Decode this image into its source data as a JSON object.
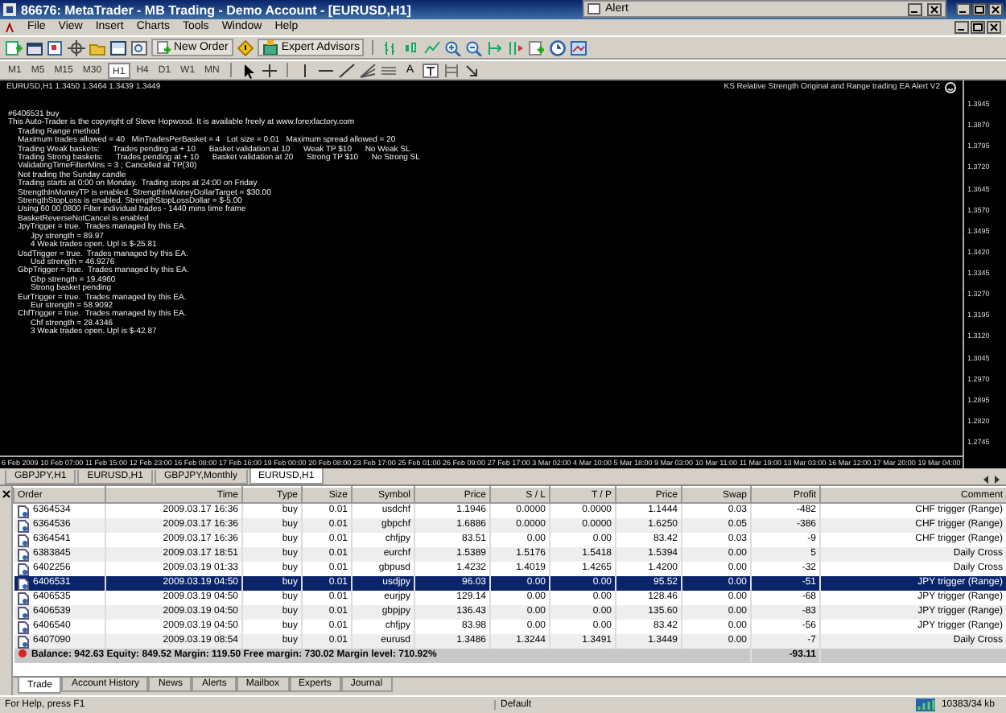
{
  "window": {
    "title": "86676: MetaTrader - MB Trading - Demo Account - [EURUSD,H1]"
  },
  "alert_window": {
    "title": "Alert"
  },
  "menu": [
    "File",
    "View",
    "Insert",
    "Charts",
    "Tools",
    "Window",
    "Help"
  ],
  "toolbar": {
    "buttons": [
      {
        "label": "New Order"
      },
      {
        "label": "Expert Advisors"
      }
    ]
  },
  "timeframes": [
    {
      "label": "M1",
      "selected": false
    },
    {
      "label": "M5",
      "selected": false
    },
    {
      "label": "M15",
      "selected": false
    },
    {
      "label": "M30",
      "selected": false
    },
    {
      "label": "H1",
      "selected": true
    },
    {
      "label": "H4",
      "selected": false
    },
    {
      "label": "D1",
      "selected": false
    },
    {
      "label": "W1",
      "selected": false
    },
    {
      "label": "MN",
      "selected": false
    }
  ],
  "drawing_tools": {
    "text_tool": "A"
  },
  "chart": {
    "header": "EURUSD,H1  1.3450 1.3464 1.3439 1.3449",
    "ea_name": "KS Relative Strength Original and Range trading EA Alert V2",
    "log": [
      {
        "kind": "title",
        "text": "#6406531 buy"
      },
      {
        "kind": "title",
        "text": "This Auto-Trader is the copyright of Steve Hopwood. It is available freely at www.forexfactory.com"
      },
      {
        "kind": "setting",
        "text": "Trading Range method"
      },
      {
        "kind": "setting",
        "text": "Maximum trades allowed = 40   MinTradesPerBasket = 4   Lot size = 0.01   Maximum spread allowed = 20"
      },
      {
        "kind": "setting",
        "text": "Trading Weak baskets:      Trades pending at + 10      Basket validation at 10      Weak TP $10      No Weak SL"
      },
      {
        "kind": "setting",
        "text": "Trading Strong baskets:      Trades pending at + 10      Basket validation at 20      Strong TP $10      No Strong SL"
      },
      {
        "kind": "setting",
        "text": "ValidatingTimeFilterMins = 3 ; Cancelled at TP(30)"
      },
      {
        "kind": "setting",
        "text": "Not trading the Sunday candle"
      },
      {
        "kind": "setting",
        "text": "Trading starts at 0:00 on Monday.  Trading stops at 24:00 on Friday"
      },
      {
        "kind": "setting",
        "text": "StrengthInMoneyTP is enabled. StrengthInMoneyDollarTarget = $30.00"
      },
      {
        "kind": "setting",
        "text": "StrengthStopLoss is enabled. StrengthStopLossDollar = $-5.00"
      },
      {
        "kind": "setting",
        "text": "Using 60 00 0800 Filter individual trades - 1440 mins time frame"
      },
      {
        "kind": "setting",
        "text": "BasketReverseNotCancel is enabled"
      },
      {
        "kind": "setting",
        "text": "JpyTrigger = true.  Trades managed by this EA."
      },
      {
        "kind": "detail",
        "text": "Jpy strength = 89.97"
      },
      {
        "kind": "detail",
        "text": "4 Weak trades open. Upl is $-25.81"
      },
      {
        "kind": "setting",
        "text": "UsdTrigger = true.  Trades managed by this EA."
      },
      {
        "kind": "detail",
        "text": "Usd strength = 46.9276"
      },
      {
        "kind": "setting",
        "text": "GbpTrigger = true.  Trades managed by this EA."
      },
      {
        "kind": "detail",
        "text": "Gbp strength = 19.4960"
      },
      {
        "kind": "detail",
        "text": "Strong basket pending"
      },
      {
        "kind": "setting",
        "text": "EurTrigger = true.  Trades managed by this EA."
      },
      {
        "kind": "detail",
        "text": "Eur strength = 58.9092"
      },
      {
        "kind": "setting",
        "text": "ChfTrigger = true.  Trades managed by this EA."
      },
      {
        "kind": "detail",
        "text": "Chf strength = 28.4346"
      },
      {
        "kind": "detail",
        "text": "3 Weak trades open. Upl is $-42.87"
      }
    ],
    "price_scale": [
      "1.3945",
      "1.3870",
      "1.3795",
      "1.3720",
      "1.3645",
      "1.3570",
      "1.3495",
      "1.3420",
      "1.3345",
      "1.3270",
      "1.3195",
      "1.3120",
      "1.3045",
      "1.2970",
      "1.2895",
      "1.2820",
      "1.2745"
    ],
    "time_scale": [
      "6 Feb 2009",
      "10 Feb 07:00",
      "11 Feb 15:00",
      "12 Feb 23:00",
      "16 Feb 08:00",
      "17 Feb 16:00",
      "19 Feb 00:00",
      "20 Feb 08:00",
      "23 Feb 17:00",
      "25 Feb 01:00",
      "26 Feb 09:00",
      "27 Feb 17:00",
      "3 Mar 02:00",
      "4 Mar 10:00",
      "5 Mar 18:00",
      "9 Mar 03:00",
      "10 Mar 11:00",
      "11 Mar 19:00",
      "13 Mar 03:00",
      "16 Mar 12:00",
      "17 Mar 20:00",
      "19 Mar 04:00"
    ]
  },
  "chart_tabs": [
    {
      "label": "GBPJPY,H1",
      "selected": false
    },
    {
      "label": "EURUSD,H1",
      "selected": false
    },
    {
      "label": "GBPJPY,Monthly",
      "selected": false
    },
    {
      "label": "EURUSD,H1",
      "selected": true
    }
  ],
  "terminal": {
    "columns": [
      "Order",
      "Time",
      "Type",
      "Size",
      "Symbol",
      "Price",
      "S / L",
      "T / P",
      "Price",
      "Swap",
      "Profit",
      "Comment"
    ],
    "rows": [
      {
        "selected": false,
        "cells": [
          "6364534",
          "2009.03.17 16:36",
          "buy",
          "0.01",
          "usdchf",
          "1.1946",
          "0.0000",
          "0.0000",
          "1.1444",
          "0.03",
          "-482",
          "CHF trigger (Range)"
        ]
      },
      {
        "selected": false,
        "cells": [
          "6364536",
          "2009.03.17 16:36",
          "buy",
          "0.01",
          "gbpchf",
          "1.6886",
          "0.0000",
          "0.0000",
          "1.6250",
          "0.05",
          "-386",
          "CHF trigger (Range)"
        ]
      },
      {
        "selected": false,
        "cells": [
          "6364541",
          "2009.03.17 16:36",
          "buy",
          "0.01",
          "chfjpy",
          "83.51",
          "0.00",
          "0.00",
          "83.42",
          "0.03",
          "-9",
          "CHF trigger (Range)"
        ]
      },
      {
        "selected": false,
        "cells": [
          "6383845",
          "2009.03.17 18:51",
          "buy",
          "0.01",
          "eurchf",
          "1.5389",
          "1.5176",
          "1.5418",
          "1.5394",
          "0.00",
          "5",
          "Daily Cross"
        ]
      },
      {
        "selected": false,
        "cells": [
          "6402256",
          "2009.03.19 01:33",
          "buy",
          "0.01",
          "gbpusd",
          "1.4232",
          "1.4019",
          "1.4265",
          "1.4200",
          "0.00",
          "-32",
          "Daily Cross"
        ]
      },
      {
        "selected": true,
        "cells": [
          "6406531",
          "2009.03.19 04:50",
          "buy",
          "0.01",
          "usdjpy",
          "96.03",
          "0.00",
          "0.00",
          "95.52",
          "0.00",
          "-51",
          "JPY trigger (Range)"
        ]
      },
      {
        "selected": false,
        "cells": [
          "6406535",
          "2009.03.19 04:50",
          "buy",
          "0.01",
          "eurjpy",
          "129.14",
          "0.00",
          "0.00",
          "128.46",
          "0.00",
          "-68",
          "JPY trigger (Range)"
        ]
      },
      {
        "selected": false,
        "cells": [
          "6406539",
          "2009.03.19 04:50",
          "buy",
          "0.01",
          "gbpjpy",
          "136.43",
          "0.00",
          "0.00",
          "135.60",
          "0.00",
          "-83",
          "JPY trigger (Range)"
        ]
      },
      {
        "selected": false,
        "cells": [
          "6406540",
          "2009.03.19 04:50",
          "buy",
          "0.01",
          "chfjpy",
          "83.98",
          "0.00",
          "0.00",
          "83.42",
          "0.00",
          "-56",
          "JPY trigger (Range)"
        ]
      },
      {
        "selected": false,
        "cells": [
          "6407090",
          "2009.03.19 08:54",
          "buy",
          "0.01",
          "eurusd",
          "1.3486",
          "1.3244",
          "1.3491",
          "1.3449",
          "0.00",
          "-7",
          "Daily Cross"
        ]
      }
    ],
    "summary": {
      "text": "Balance: 942.63  Equity: 849.52  Margin: 119.50  Free margin: 730.02  Margin level: 710.92%",
      "profit": "-93.11"
    },
    "tabs": [
      {
        "label": "Trade",
        "selected": true
      },
      {
        "label": "Account History",
        "selected": false
      },
      {
        "label": "News",
        "selected": false
      },
      {
        "label": "Alerts",
        "selected": false
      },
      {
        "label": "Mailbox",
        "selected": false
      },
      {
        "label": "Experts",
        "selected": false
      },
      {
        "label": "Journal",
        "selected": false
      }
    ]
  },
  "status_bar": {
    "help": "For Help, press F1",
    "profile": "Default",
    "traffic": "10383/34 kb"
  }
}
